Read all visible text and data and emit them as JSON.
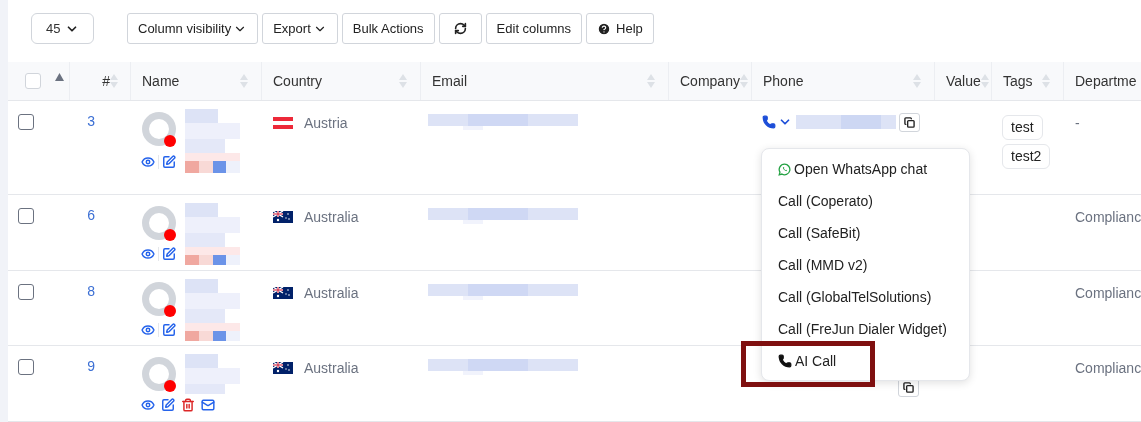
{
  "toolbar": {
    "page_size": "45",
    "buttons": [
      {
        "kind": "dropdown",
        "label": "Column visibility"
      },
      {
        "kind": "dropdown",
        "label": "Export"
      },
      {
        "kind": "plain",
        "label": "Bulk Actions"
      },
      {
        "kind": "refresh"
      },
      {
        "kind": "plain",
        "label": "Edit columns"
      },
      {
        "kind": "help",
        "label": "Help"
      }
    ]
  },
  "table": {
    "columns": [
      "#",
      "Name",
      "Country",
      "Email",
      "Company",
      "Phone",
      "Value",
      "Tags",
      "Departme"
    ],
    "all_checked": false,
    "rows": [
      {
        "checked": false,
        "number": "3",
        "country": "Austria",
        "flag": {
          "kind": "austria"
        },
        "color": "#ff0000",
        "actions": [
          {
            "kind": "view"
          },
          {
            "kind": "edit"
          }
        ],
        "phone": {
          "kind": "full"
        },
        "tags": [
          "test",
          "test2"
        ],
        "department": "-"
      },
      {
        "checked": false,
        "number": "6",
        "country": "Australia",
        "flag": {
          "kind": "australia"
        },
        "color": "#ff0000",
        "actions": [
          {
            "kind": "view"
          },
          {
            "kind": "edit"
          }
        ],
        "tags": [],
        "department": "Complianc"
      },
      {
        "checked": false,
        "number": "8",
        "country": "Australia",
        "flag": {
          "kind": "australia"
        },
        "color": "#ff0000",
        "actions": [
          {
            "kind": "view"
          },
          {
            "kind": "edit"
          }
        ],
        "tags": [],
        "department": "Complianc"
      },
      {
        "checked": false,
        "number": "9",
        "country": "Australia",
        "flag": {
          "kind": "australia"
        },
        "color": "#ff0000",
        "actions": [
          {
            "kind": "view"
          },
          {
            "kind": "edit"
          },
          {
            "kind": "delete"
          },
          {
            "kind": "email"
          }
        ],
        "phone": {
          "kind": "copy_only"
        },
        "tags": [],
        "department": "Complianc"
      }
    ]
  },
  "phone_menu": {
    "items": [
      {
        "kind": "whatsapp",
        "label": "Open WhatsApp chat",
        "highlighted": false
      },
      {
        "kind": "plain",
        "label": "Call (Coperato)",
        "highlighted": false
      },
      {
        "kind": "plain",
        "label": "Call (SafeBit)",
        "highlighted": false
      },
      {
        "kind": "plain",
        "label": "Call (MMD v2)",
        "highlighted": false
      },
      {
        "kind": "plain",
        "label": "Call (GlobalTelSolutions)",
        "highlighted": false
      },
      {
        "kind": "plain",
        "label": "Call (FreJun Dialer Widget)",
        "highlighted": false
      },
      {
        "kind": "phone",
        "label": "AI Call",
        "highlighted": true
      }
    ]
  }
}
